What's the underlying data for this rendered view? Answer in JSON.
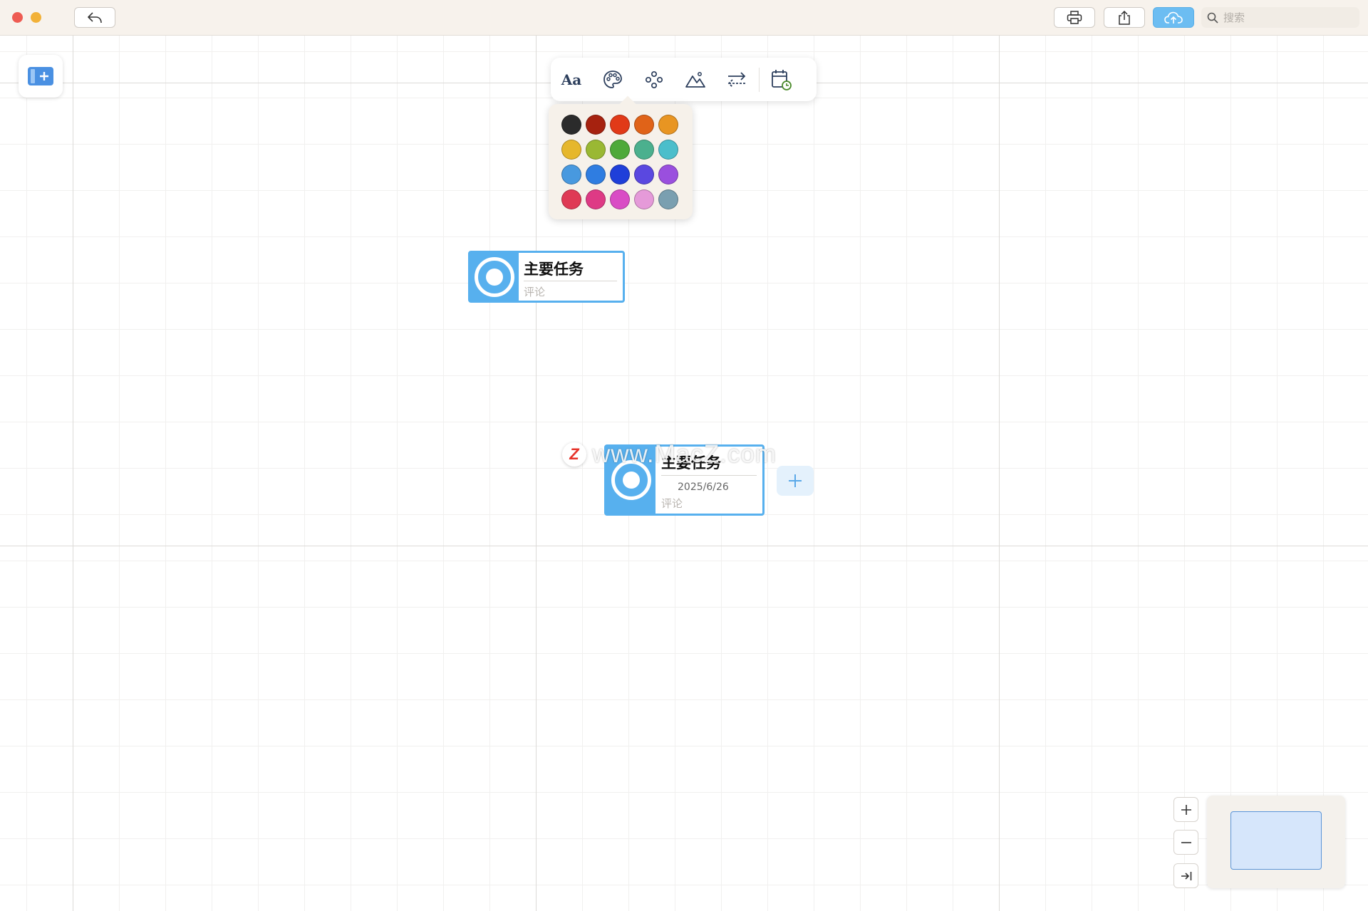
{
  "titlebar": {
    "search": {
      "placeholder": "搜索",
      "icon": "search-icon"
    },
    "buttons": {
      "back": "undo-icon",
      "print": "print-icon",
      "share": "share-icon",
      "cloud": "cloud-upload-icon"
    }
  },
  "toolbar": {
    "tools": [
      "text-style-icon",
      "palette-icon",
      "nodes-icon",
      "image-icon",
      "arrows-icon",
      "calendar-icon"
    ],
    "active": "palette-icon"
  },
  "color_palette": {
    "colors": [
      "#2b2b2b",
      "#a6220f",
      "#e13a18",
      "#e06318",
      "#e89522",
      "#e6b72c",
      "#9ab833",
      "#4ea93a",
      "#4bb08e",
      "#4bbecb",
      "#4899df",
      "#2f7de1",
      "#1f3fd9",
      "#5a48e0",
      "#9a4fde",
      "#df3a55",
      "#de3a85",
      "#d94cc5",
      "#e59ad9",
      "#7a9fb0"
    ]
  },
  "nodes": [
    {
      "title": "主要任务",
      "comment": "评论"
    },
    {
      "title": "主要任务",
      "date": "2025/6/26",
      "comment": "评论"
    }
  ],
  "watermark": {
    "badge": "Z",
    "text": "www.MacZ.com"
  },
  "theme": {
    "accent": "#57b0ee",
    "cloud_button": "#6cbdf2"
  }
}
